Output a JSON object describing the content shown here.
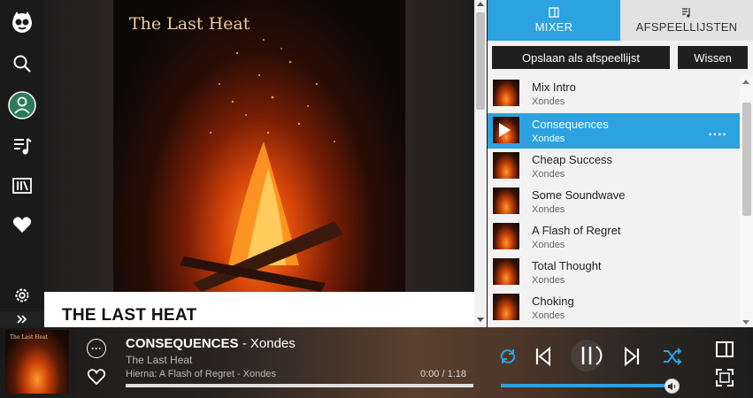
{
  "app": {
    "name": "Napster"
  },
  "nav": {
    "items": [
      {
        "icon": "napster-logo-icon"
      },
      {
        "icon": "search-icon"
      },
      {
        "icon": "profile-icon"
      },
      {
        "icon": "playlist-icon"
      },
      {
        "icon": "library-icon"
      },
      {
        "icon": "heart-icon"
      },
      {
        "icon": "gear-icon"
      },
      {
        "icon": "expand-chevron-icon"
      }
    ]
  },
  "main": {
    "album_art_title": "The Last Heat",
    "page_title": "THE LAST HEAT"
  },
  "panel": {
    "tabs": [
      {
        "label": "MIXER",
        "icon": "mixer-icon",
        "active": true
      },
      {
        "label": "AFSPEELLIJSTEN",
        "icon": "playlists-icon",
        "active": false
      }
    ],
    "save_playlist_label": "Opslaan als afspeellijst",
    "clear_label": "Wissen",
    "tracks": [
      {
        "title": "Mix Intro",
        "artist": "Xondes",
        "selected": false
      },
      {
        "title": "Consequences",
        "artist": "Xondes",
        "selected": true,
        "more": "...."
      },
      {
        "title": "Cheap Success",
        "artist": "Xondes",
        "selected": false
      },
      {
        "title": "Some Soundwave",
        "artist": "Xondes",
        "selected": false
      },
      {
        "title": "A Flash of Regret",
        "artist": "Xondes",
        "selected": false
      },
      {
        "title": "Total Thought",
        "artist": "Xondes",
        "selected": false
      },
      {
        "title": "Choking",
        "artist": "Xondes",
        "selected": false
      }
    ]
  },
  "player": {
    "album_art_text": "The Last Heat",
    "song": "CONSEQUENCES",
    "separator": " - ",
    "artist": "Xondes",
    "album": "The Last Heat",
    "next_up": "Hierna: A Flash of Regret - Xondes",
    "time": "0:00 / 1:18",
    "progress": 0.0,
    "volume": 1.0,
    "more_symbol": "···",
    "accent": "#2ca2e0"
  }
}
